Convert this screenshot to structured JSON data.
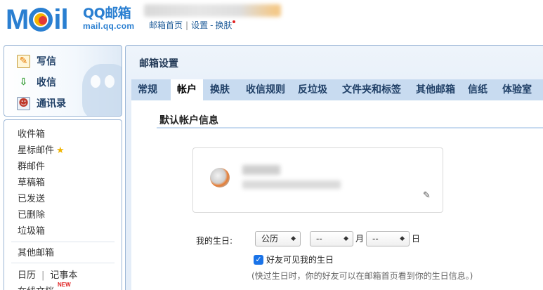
{
  "header": {
    "logo_cn": "QQ邮箱",
    "logo_url": "mail.qq.com",
    "links": [
      "邮箱首页",
      "设置",
      "换肤"
    ],
    "link_sep": "|",
    "link_dash": "-"
  },
  "sidebar": {
    "quick": [
      {
        "label": "写信",
        "icon": "compose-icon"
      },
      {
        "label": "收信",
        "icon": "inbox-download-icon"
      },
      {
        "label": "通讯录",
        "icon": "contacts-icon"
      }
    ],
    "folders": [
      "收件箱",
      "星标邮件",
      "群邮件",
      "草稿箱",
      "已发送",
      "已删除",
      "垃圾箱"
    ],
    "other_mailbox": "其他邮箱",
    "calendar": "日历",
    "notes": "记事本",
    "online_docs": "在线文档",
    "new_badge": "NEW"
  },
  "main": {
    "title": "邮箱设置",
    "tabs": [
      "常规",
      "帐户",
      "换肤",
      "收信规则",
      "反垃圾",
      "文件夹和标签",
      "其他邮箱",
      "信纸",
      "体验室"
    ],
    "active_tab": "帐户",
    "section_title": "默认帐户信息",
    "birthday": {
      "label": "我的生日:",
      "calendar_type": "公历",
      "month": "--",
      "month_unit": "月",
      "day": "--",
      "day_unit": "日"
    },
    "friends_visible": {
      "checked": true,
      "label": "好友可见我的生日"
    },
    "hint": "(快过生日时，你的好友可以在邮箱首页看到你的生日信息。)"
  },
  "colors": {
    "brand_blue": "#2a7fd1",
    "tab_bar": "#c8dbf0",
    "panel_border": "#9bb6d6",
    "checkbox_blue": "#1a73e8"
  }
}
